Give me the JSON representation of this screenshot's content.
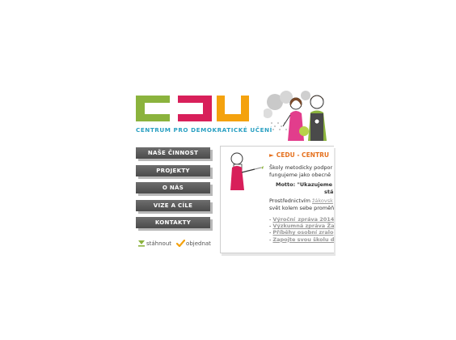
{
  "logo": {
    "letters": "CEDU",
    "tagline": "CENTRUM PRO DEMOKRATICKÉ UČENÍ",
    "colors": {
      "c": "#8bb33d",
      "e": "#d81f5a",
      "u": "#f4a20e",
      "tagline": "#2aa0c2"
    }
  },
  "nav": {
    "items": [
      {
        "label": "NAŠE ČINNOST"
      },
      {
        "label": "PROJEKTY"
      },
      {
        "label": "O NÁS"
      },
      {
        "label": "VIZE A CÍLE"
      },
      {
        "label": "KONTAKTY"
      }
    ]
  },
  "downloads": {
    "download_label": "stáhnout",
    "order_label": "objednat"
  },
  "content": {
    "title": "CEDU - CENTRU",
    "intro_line1": "Školy metodicky podpor",
    "intro_line2": "fungujeme jako obecně",
    "motto_line1": "Motto: \"Ukazujeme",
    "motto_line2": "stá",
    "para_prefix": "Prostřednictvím ",
    "para_link": "žákovsk",
    "para_line2": "svět kolem sebe proměň",
    "links": [
      "Výroční_zpráva 2014",
      "Výzkumná zpráva Ža",
      "Příběhy osobní zralo",
      "Zapojte svou školu d"
    ]
  },
  "accent_colors": {
    "nav_bg": "#555555",
    "title": "#e5711e",
    "link": "#999999"
  }
}
